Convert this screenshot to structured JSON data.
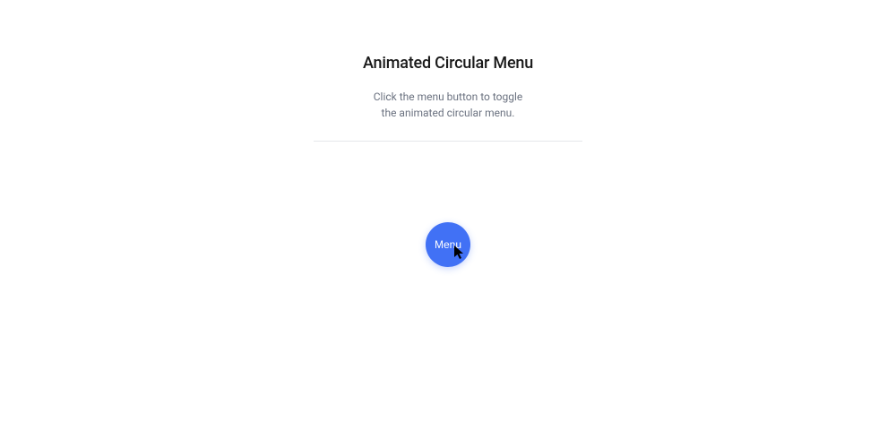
{
  "header": {
    "title": "Animated Circular Menu",
    "description_line1": "Click the menu button to toggle",
    "description_line2": "the animated circular menu."
  },
  "menu": {
    "button_label": "Menu"
  },
  "colors": {
    "accent": "#4171f5",
    "text_primary": "#1a1a1a",
    "text_secondary": "#6b7280",
    "divider": "#e5e7eb"
  }
}
